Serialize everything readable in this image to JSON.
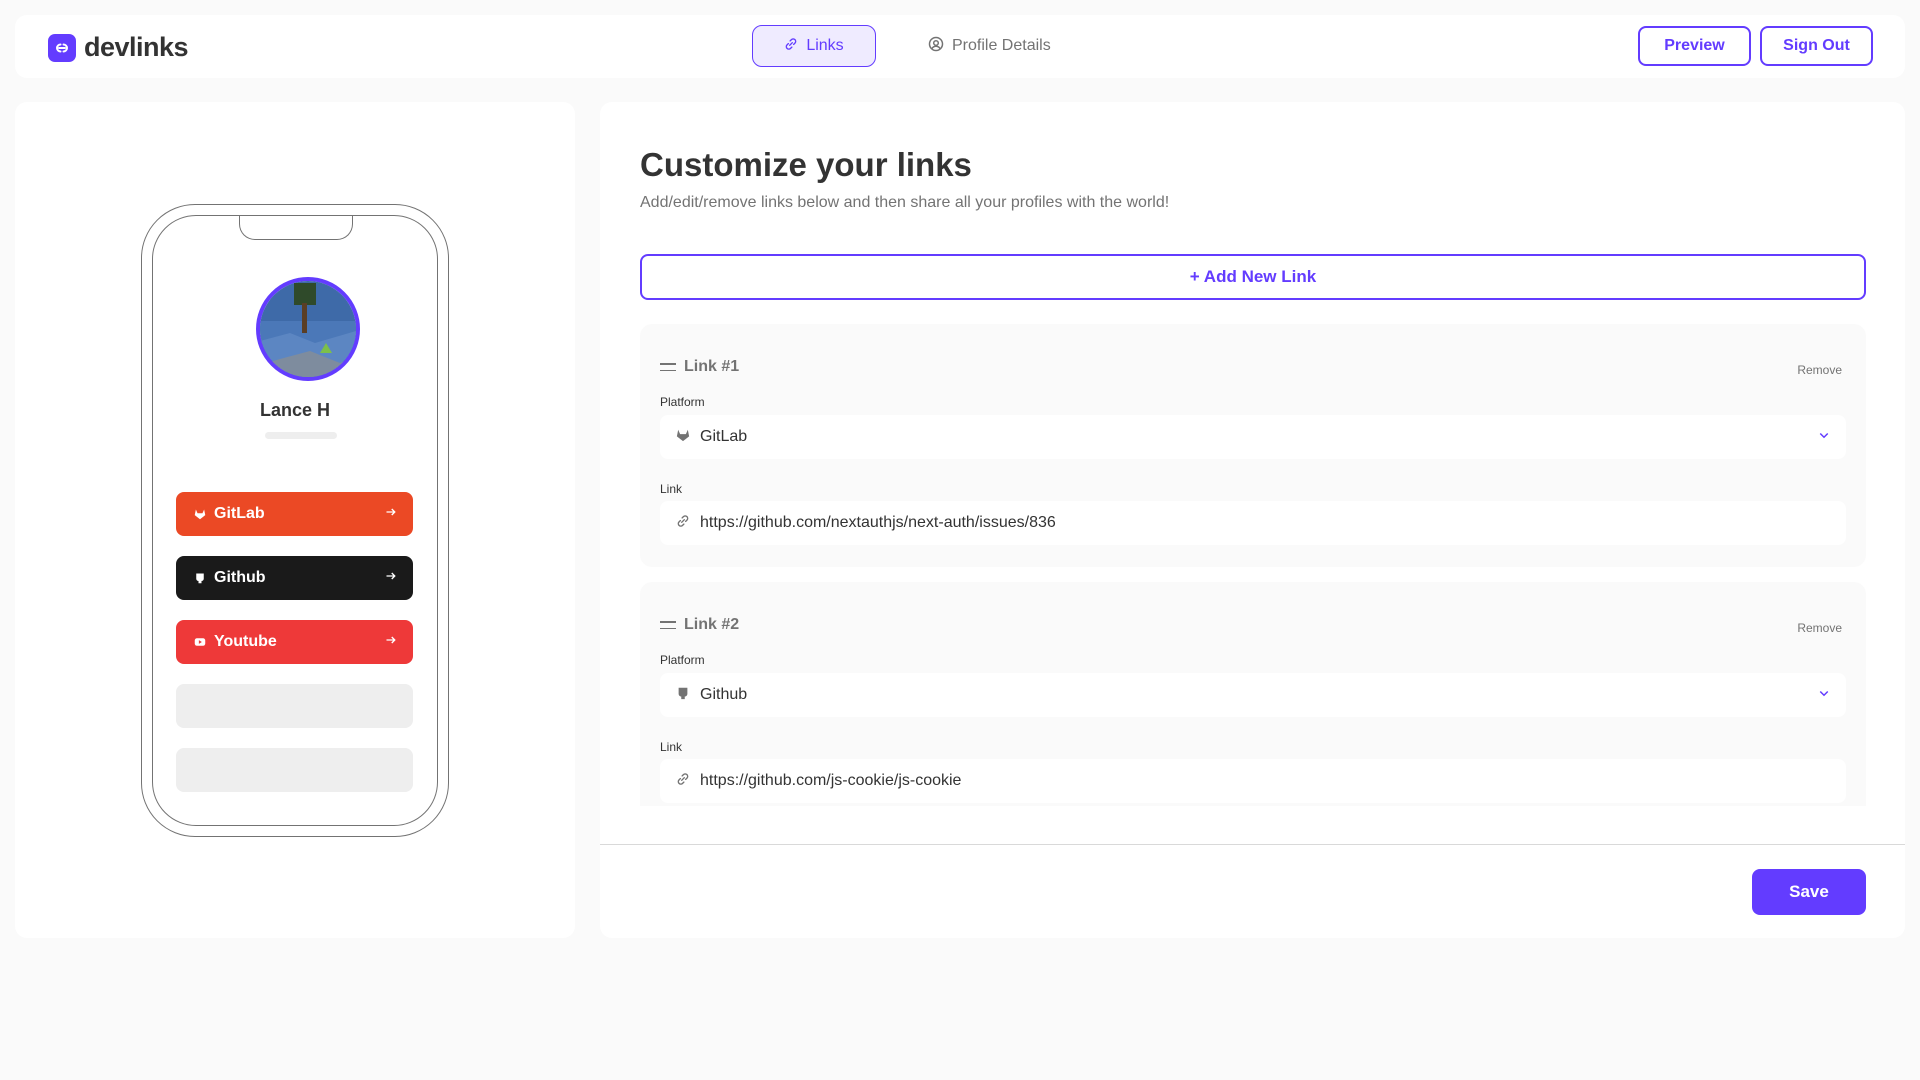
{
  "app": {
    "name": "devlinks"
  },
  "nav": {
    "tabs": [
      {
        "label": "Links",
        "icon": "link-icon",
        "active": true
      },
      {
        "label": "Profile Details",
        "icon": "user-circle-icon",
        "active": false
      }
    ],
    "preview_label": "Preview",
    "signout_label": "Sign Out"
  },
  "preview": {
    "name": "Lance H",
    "links": [
      {
        "label": "GitLab",
        "icon": "gitlab-icon",
        "color": "#EB4925"
      },
      {
        "label": "Github",
        "icon": "github-icon",
        "color": "#1A1A1A"
      },
      {
        "label": "Youtube",
        "icon": "youtube-icon",
        "color": "#EE3939"
      }
    ],
    "empty_slots": 2
  },
  "editor": {
    "title": "Customize your links",
    "subtitle": "Add/edit/remove links below and then share all your profiles with the world!",
    "add_label": "+ Add New Link",
    "links": [
      {
        "heading": "Link #1",
        "remove_label": "Remove",
        "platform_label": "Platform",
        "platform": "GitLab",
        "platform_icon": "gitlab-icon",
        "link_label": "Link",
        "url": "https://github.com/nextauthjs/next-auth/issues/836"
      },
      {
        "heading": "Link #2",
        "remove_label": "Remove",
        "platform_label": "Platform",
        "platform": "Github",
        "platform_icon": "github-icon",
        "link_label": "Link",
        "url": "https://github.com/js-cookie/js-cookie"
      }
    ],
    "save_label": "Save"
  },
  "colors": {
    "accent": "#633CFF",
    "accent_light": "#EFEBFF",
    "gitlab": "#EB4925",
    "github": "#1A1A1A",
    "youtube": "#EE3939"
  }
}
